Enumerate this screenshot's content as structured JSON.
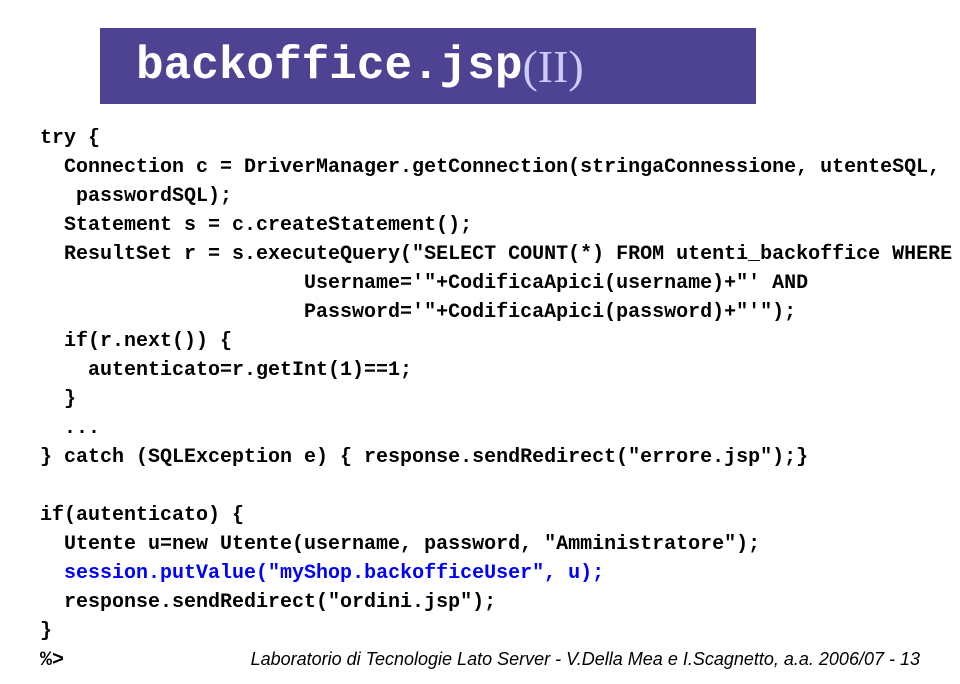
{
  "title": {
    "main": "backoffice.jsp",
    "sub": "(II)"
  },
  "code": {
    "l01a": "try {",
    "l02a": "  Connection c = DriverManager.getConnection(stringaConnessione, utenteSQL,",
    "l03a": "   passwordSQL);",
    "l04a": "  Statement s = c.createStatement();",
    "l05a": "  ResultSet r = s.executeQuery(\"SELECT COUNT(*) FROM utenti_backoffice WHERE",
    "l06a": "                      Username='\"+CodificaApici(username)+\"' AND",
    "l07a": "                      Password='\"+CodificaApici(password)+\"'\");",
    "l08a": "  if(r.next()) {",
    "l09a": "    autenticato=r.getInt(1)==1;",
    "l10a": "  }",
    "l11a": "  ...",
    "l12a": "} catch (SQLException e) { response.sendRedirect(\"errore.jsp\");}",
    "blank": "",
    "l13a": "if(autenticato) {",
    "l14a": "  Utente u=new Utente(username, password, \"Amministratore\");",
    "l15a": "  ",
    "l15b": "session.putValue(\"myShop.backofficeUser\", u);",
    "l16a": "  response.sendRedirect(\"ordini.jsp\");",
    "l17a": "}",
    "l18a": "%>"
  },
  "footer": "Laboratorio di Tecnologie Lato Server - V.Della Mea e I.Scagnetto, a.a. 2006/07 - 13"
}
